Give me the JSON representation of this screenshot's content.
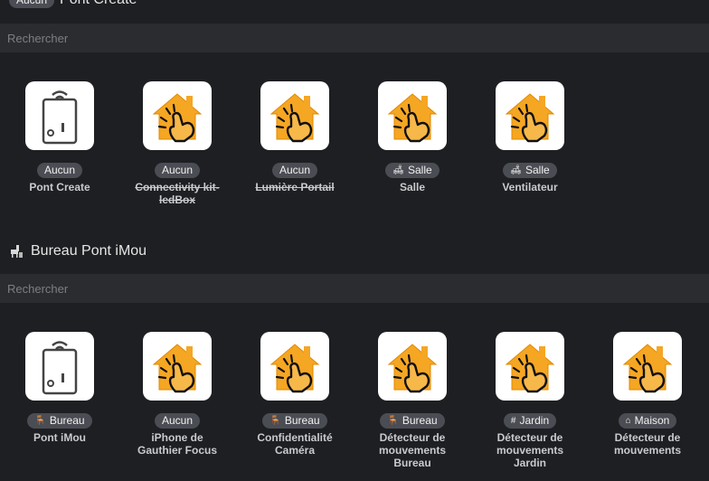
{
  "top": {
    "badge": "Aucun",
    "title": "Pont Create"
  },
  "section1": {
    "search_placeholder": "Rechercher",
    "tiles": [
      {
        "icon": "remote-switch-icon",
        "badge": "Aucun",
        "badge_icon": "",
        "name": "Pont Create",
        "strike": false
      },
      {
        "icon": "home-tap-icon",
        "badge": "Aucun",
        "badge_icon": "",
        "name": "Connectivity kit-ledBox",
        "strike": true
      },
      {
        "icon": "home-tap-icon",
        "badge": "Aucun",
        "badge_icon": "",
        "name": "Lumière Portail",
        "strike": true
      },
      {
        "icon": "home-tap-icon",
        "badge": "Salle",
        "badge_icon": "sofa-icon",
        "name": "Salle",
        "strike": false
      },
      {
        "icon": "home-tap-icon",
        "badge": "Salle",
        "badge_icon": "sofa-icon",
        "name": "Ventilateur",
        "strike": false
      }
    ]
  },
  "section2": {
    "title": "Bureau Pont iMou",
    "title_icon": "desk-chair-icon",
    "search_placeholder": "Rechercher",
    "tiles": [
      {
        "icon": "remote-switch-icon",
        "badge": "Bureau",
        "badge_icon": "desk-chair-icon",
        "name": "Pont iMou",
        "strike": false
      },
      {
        "icon": "home-tap-icon",
        "badge": "Aucun",
        "badge_icon": "",
        "name": "iPhone de Gauthier Focus",
        "strike": false
      },
      {
        "icon": "home-tap-icon",
        "badge": "Bureau",
        "badge_icon": "desk-chair-icon",
        "name": "Confidentialité Caméra",
        "strike": false
      },
      {
        "icon": "home-tap-icon",
        "badge": "Bureau",
        "badge_icon": "desk-chair-icon",
        "name": "Détecteur de mouvements Bureau",
        "strike": false
      },
      {
        "icon": "home-tap-icon",
        "badge": "Jardin",
        "badge_icon": "fence-icon",
        "name": "Détecteur de mouvements Jardin",
        "strike": false
      },
      {
        "icon": "home-tap-icon",
        "badge": "Maison",
        "badge_icon": "house-icon",
        "name": "Détecteur de mouvements",
        "strike": false
      }
    ]
  }
}
